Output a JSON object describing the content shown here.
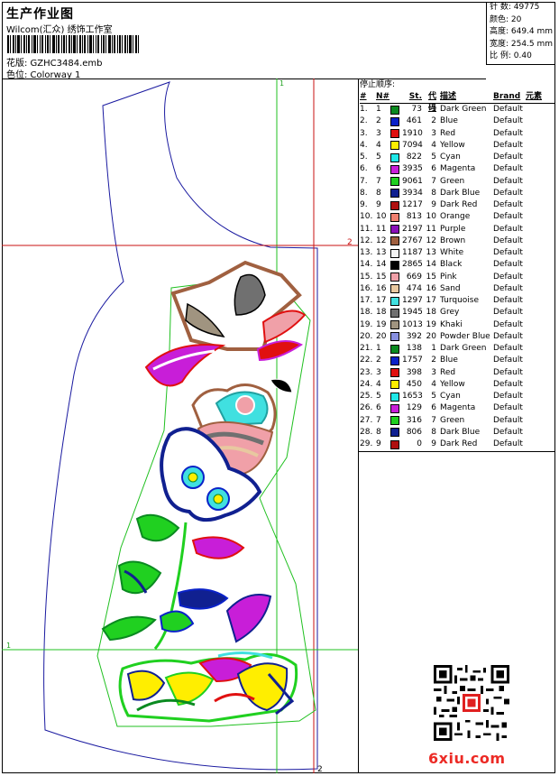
{
  "header": {
    "title": "生产作业图",
    "subtitle": "Wilcom(汇众) 绣饰工作室",
    "design_label": "花版: GZHC3484.emb",
    "color_label": "色位: Colorway 1"
  },
  "info": {
    "stitches": "针 数: 49775",
    "colors": "颜色: 20",
    "height": "高度: 649.4 mm",
    "width": "宽度: 254.5 mm",
    "scale": "比 例: 0.40"
  },
  "guides": {
    "v1_label": "1",
    "v2_label": "2",
    "h1_label": "1",
    "h2_label": "2"
  },
  "stop_sequence": {
    "title": "停止顺序:",
    "headers": {
      "seq": "#",
      "no": "N#",
      "st": "St.",
      "code": "代码",
      "desc": "描述",
      "brand": "Brand",
      "el": "元素"
    },
    "rows": [
      {
        "seq": "1.",
        "no": "1",
        "color": "#0a8a20",
        "st": "73",
        "code": "1",
        "desc": "Dark Green",
        "brand": "Default"
      },
      {
        "seq": "2.",
        "no": "2",
        "color": "#0a22c8",
        "st": "461",
        "code": "2",
        "desc": "Blue",
        "brand": "Default"
      },
      {
        "seq": "3.",
        "no": "3",
        "color": "#e01010",
        "st": "1910",
        "code": "3",
        "desc": "Red",
        "brand": "Default"
      },
      {
        "seq": "4.",
        "no": "4",
        "color": "#ffee00",
        "st": "7094",
        "code": "4",
        "desc": "Yellow",
        "brand": "Default"
      },
      {
        "seq": "5.",
        "no": "5",
        "color": "#20e8e8",
        "st": "822",
        "code": "5",
        "desc": "Cyan",
        "brand": "Default"
      },
      {
        "seq": "6.",
        "no": "6",
        "color": "#c81ed8",
        "st": "3935",
        "code": "6",
        "desc": "Magenta",
        "brand": "Default"
      },
      {
        "seq": "7.",
        "no": "7",
        "color": "#20d020",
        "st": "9061",
        "code": "7",
        "desc": "Green",
        "brand": "Default"
      },
      {
        "seq": "8.",
        "no": "8",
        "color": "#102090",
        "st": "3934",
        "code": "8",
        "desc": "Dark Blue",
        "brand": "Default"
      },
      {
        "seq": "9.",
        "no": "9",
        "color": "#b01010",
        "st": "1217",
        "code": "9",
        "desc": "Dark Red",
        "brand": "Default"
      },
      {
        "seq": "10.",
        "no": "10",
        "color": "#f08070",
        "st": "813",
        "code": "10",
        "desc": "Orange",
        "brand": "Default"
      },
      {
        "seq": "11.",
        "no": "11",
        "color": "#8a10b8",
        "st": "2197",
        "code": "11",
        "desc": "Purple",
        "brand": "Default"
      },
      {
        "seq": "12.",
        "no": "12",
        "color": "#a06040",
        "st": "2767",
        "code": "12",
        "desc": "Brown",
        "brand": "Default"
      },
      {
        "seq": "13.",
        "no": "13",
        "color": "#f4f4f4",
        "st": "1187",
        "code": "13",
        "desc": "White",
        "brand": "Default"
      },
      {
        "seq": "14.",
        "no": "14",
        "color": "#000000",
        "st": "2865",
        "code": "14",
        "desc": "Black",
        "brand": "Default"
      },
      {
        "seq": "15.",
        "no": "15",
        "color": "#f0a0a8",
        "st": "669",
        "code": "15",
        "desc": "Pink",
        "brand": "Default"
      },
      {
        "seq": "16.",
        "no": "16",
        "color": "#e8c8a0",
        "st": "474",
        "code": "16",
        "desc": "Sand",
        "brand": "Default"
      },
      {
        "seq": "17.",
        "no": "17",
        "color": "#40e0e0",
        "st": "1297",
        "code": "17",
        "desc": "Turquoise",
        "brand": "Default"
      },
      {
        "seq": "18.",
        "no": "18",
        "color": "#707070",
        "st": "1945",
        "code": "18",
        "desc": "Grey",
        "brand": "Default"
      },
      {
        "seq": "19.",
        "no": "19",
        "color": "#a09480",
        "st": "1013",
        "code": "19",
        "desc": "Khaki",
        "brand": "Default"
      },
      {
        "seq": "20.",
        "no": "20",
        "color": "#8890e0",
        "st": "392",
        "code": "20",
        "desc": "Powder Blue",
        "brand": "Default"
      },
      {
        "seq": "21.",
        "no": "1",
        "color": "#0a8a20",
        "st": "138",
        "code": "1",
        "desc": "Dark Green",
        "brand": "Default"
      },
      {
        "seq": "22.",
        "no": "2",
        "color": "#0a22c8",
        "st": "1757",
        "code": "2",
        "desc": "Blue",
        "brand": "Default"
      },
      {
        "seq": "23.",
        "no": "3",
        "color": "#e01010",
        "st": "398",
        "code": "3",
        "desc": "Red",
        "brand": "Default"
      },
      {
        "seq": "24.",
        "no": "4",
        "color": "#ffee00",
        "st": "450",
        "code": "4",
        "desc": "Yellow",
        "brand": "Default"
      },
      {
        "seq": "25.",
        "no": "5",
        "color": "#20e8e8",
        "st": "1653",
        "code": "5",
        "desc": "Cyan",
        "brand": "Default"
      },
      {
        "seq": "26.",
        "no": "6",
        "color": "#c81ed8",
        "st": "129",
        "code": "6",
        "desc": "Magenta",
        "brand": "Default"
      },
      {
        "seq": "27.",
        "no": "7",
        "color": "#20d020",
        "st": "316",
        "code": "7",
        "desc": "Green",
        "brand": "Default"
      },
      {
        "seq": "28.",
        "no": "8",
        "color": "#102090",
        "st": "806",
        "code": "8",
        "desc": "Dark Blue",
        "brand": "Default"
      },
      {
        "seq": "29.",
        "no": "9",
        "color": "#b01010",
        "st": "0",
        "code": "9",
        "desc": "Dark Red",
        "brand": "Default"
      }
    ]
  },
  "watermark": {
    "text": "6xiu.com"
  }
}
